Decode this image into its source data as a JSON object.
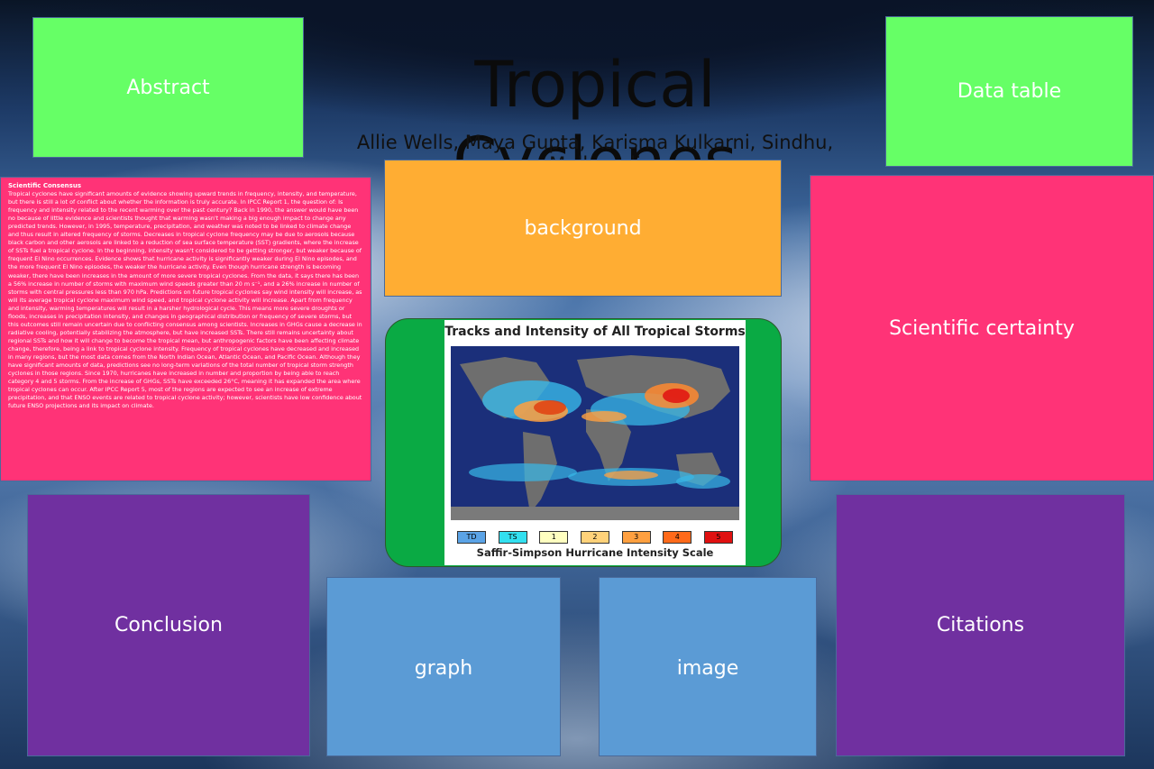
{
  "title": "Tropical Cyclones",
  "authors": "Allie Wells, Maya Gupta, Karisma Kulkarni, Sindhu, Mullapudi",
  "boxes": {
    "abstract": "Abstract",
    "data_table": "Data table",
    "background": "background",
    "scientific_certainty": "Scientific certainty",
    "conclusion": "Conclusion",
    "graph": "graph",
    "image": "image",
    "citations": "Citations"
  },
  "consensus": {
    "heading": "Scientific Consensus",
    "body": "Tropical cyclones have significant amounts of evidence showing upward trends in frequency, intensity, and temperature, but there is still a lot of conflict about whether the information is truly accurate. In IPCC Report 1, the question of: Is frequency and intensity related to the recent warming over the past century? Back in 1990, the answer would have been no because of little evidence and scientists thought that warming wasn't making a big enough impact to change any predicted trends. However, in 1995, temperature, precipitation, and weather was noted to be linked to climate change and thus result in altered frequency of storms. Decreases in tropical cyclone frequency may be due to aerosols because black carbon and other aerosols are linked to a reduction of sea surface temperature (SST) gradients, where the increase of SSTs fuel a tropical cyclone. In the beginning, intensity wasn't considered to be getting stronger, but weaker because of frequent El Nino occurrences. Evidence shows that hurricane activity is significantly weaker during El Nino episodes, and the more frequent El Nino episodes, the weaker the hurricane activity. Even though hurricane strength is becoming weaker, there have been increases in the amount of more severe tropical cyclones. From the data, it says there has been a 56% increase in number of storms with maximum wind speeds greater than 20 m s⁻¹, and a 26% increase in number of storms with central pressures less than 970 hPa. Predictions on future tropical cyclones say wind intensity will increase, as will its average tropical cyclone maximum wind speed, and tropical cyclone activity will increase. Apart from frequency and intensity, warming temperatures will result in a harsher hydrological cycle. This means more severe droughts or floods, increases in precipitation intensity, and changes in geographical distribution or frequency of severe storms, but this outcomes still remain uncertain due to conflicting consensus among scientists. Increases in GHGs cause a decrease in radiative cooling, potentially stabilizing the atmosphere, but have increased SSTs. There still remains uncertainty about regional SSTs and how it will change to become the tropical mean, but anthropogenic factors have been affecting climate change, therefore, being a link to tropical cyclone intensity. Frequency of tropical cyclones have decreased and increased in many regions, but the most data comes from the North Indian Ocean, Atlantic Ocean, and Pacific Ocean. Although they have significant amounts of data, predictions see no long-term variations of the total number of tropical storm strength cyclones in those regions. Since 1970, hurricanes have increased in number and proportion by being able to reach category 4 and 5 storms. From the increase of GHGs, SSTs have exceeded 26°C, meaning it has expanded the area where tropical cyclones can occur. After IPCC Report 5, most of the regions are expected to see an increase of extreme precipitation, and that ENSO events are related to tropical cyclone activity; however, scientists have low confidence about future ENSO projections and its impact on climate."
  },
  "map_figure": {
    "title": "Tracks and Intensity of All Tropical Storms",
    "scale_label": "Saffir-Simpson Hurricane Intensity Scale",
    "legend": [
      {
        "label": "TD",
        "color": "#5ba3e6"
      },
      {
        "label": "TS",
        "color": "#33e0f0"
      },
      {
        "label": "1",
        "color": "#ffffc0"
      },
      {
        "label": "2",
        "color": "#ffd27a"
      },
      {
        "label": "3",
        "color": "#ffa040"
      },
      {
        "label": "4",
        "color": "#ff6a1a"
      },
      {
        "label": "5",
        "color": "#e01010"
      }
    ]
  },
  "colors": {
    "green": "#66ff66",
    "orange": "#ffad33",
    "pink": "#ff3377",
    "purple": "#7030a0",
    "blue": "#5b9bd5",
    "frame_green": "#0aaa44"
  }
}
